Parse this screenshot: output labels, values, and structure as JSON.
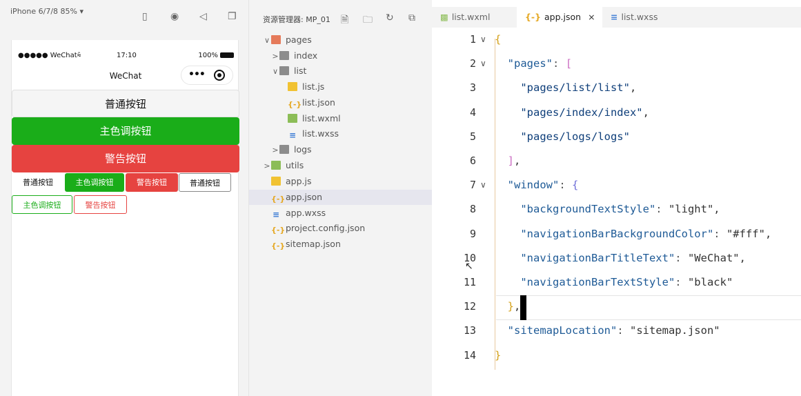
{
  "simulator": {
    "device_label": "iPhone 6/7/8 85% ▾",
    "status": {
      "signal": "●●●●● WeChat⩯",
      "time": "17:10",
      "battery": "100%"
    },
    "navbar_title": "WeChat",
    "capsule_dots": "•••",
    "buttons": {
      "default": "普通按钮",
      "primary": "主色调按钮",
      "warn": "警告按钮",
      "mini_default_1": "普通按钮",
      "mini_primary_1": "主色调按钮",
      "mini_warn_1": "警告按钮",
      "mini_default_2": "普通按钮",
      "mini_primary_plain": "主色调按钮",
      "mini_warn_plain": "警告按钮"
    },
    "tool_icons": [
      "phone-icon",
      "record-icon",
      "volume-icon",
      "window-icon"
    ]
  },
  "explorer": {
    "title": "资源管理器: MP_01",
    "tool_icons": [
      "new-file-icon",
      "new-folder-icon",
      "refresh-icon",
      "collapse-icon"
    ],
    "tree": [
      {
        "label": "pages",
        "chevron": "∨",
        "icon": "folder-red",
        "depth": 0
      },
      {
        "label": "index",
        "chevron": ">",
        "icon": "folder",
        "depth": 1
      },
      {
        "label": "list",
        "chevron": "∨",
        "icon": "folder",
        "depth": 1
      },
      {
        "label": "list.js",
        "chevron": "",
        "icon": "js",
        "depth": 2
      },
      {
        "label": "list.json",
        "chevron": "",
        "icon": "json",
        "depth": 2
      },
      {
        "label": "list.wxml",
        "chevron": "",
        "icon": "wxml",
        "depth": 2
      },
      {
        "label": "list.wxss",
        "chevron": "",
        "icon": "wxss",
        "depth": 2
      },
      {
        "label": "logs",
        "chevron": ">",
        "icon": "folder",
        "depth": 1
      },
      {
        "label": "utils",
        "chevron": ">",
        "icon": "folder-green",
        "depth": 0
      },
      {
        "label": "app.js",
        "chevron": "",
        "icon": "js",
        "depth": 0
      },
      {
        "label": "app.json",
        "chevron": "",
        "icon": "json",
        "depth": 0,
        "selected": true
      },
      {
        "label": "app.wxss",
        "chevron": "",
        "icon": "wxss",
        "depth": 0
      },
      {
        "label": "project.config.json",
        "chevron": "",
        "icon": "json",
        "depth": 0
      },
      {
        "label": "sitemap.json",
        "chevron": "",
        "icon": "json",
        "depth": 0
      }
    ]
  },
  "editor": {
    "tabs": [
      {
        "label": "list.wxml",
        "icon": "wxml-icon",
        "active": false
      },
      {
        "label": "app.json",
        "icon": "json-icon",
        "active": true,
        "close": "×"
      },
      {
        "label": "list.wxss",
        "icon": "wxss-icon",
        "active": false
      }
    ],
    "lines": [
      {
        "n": "1",
        "fold": "∨",
        "text": "{"
      },
      {
        "n": "2",
        "fold": "∨",
        "text": "  \"pages\": ["
      },
      {
        "n": "3",
        "fold": "",
        "text": "    \"pages/list/list\","
      },
      {
        "n": "4",
        "fold": "",
        "text": "    \"pages/index/index\","
      },
      {
        "n": "5",
        "fold": "",
        "text": "    \"pages/logs/logs\""
      },
      {
        "n": "6",
        "fold": "",
        "text": "  ],"
      },
      {
        "n": "7",
        "fold": "∨",
        "text": "  \"window\": {"
      },
      {
        "n": "8",
        "fold": "",
        "text": "    \"backgroundTextStyle\": \"light\","
      },
      {
        "n": "9",
        "fold": "",
        "text": "    \"navigationBarBackgroundColor\": \"#fff\","
      },
      {
        "n": "10",
        "fold": "",
        "text": "    \"navigationBarTitleText\": \"WeChat\","
      },
      {
        "n": "11",
        "fold": "",
        "text": "    \"navigationBarTextStyle\": \"black\""
      },
      {
        "n": "12",
        "fold": "",
        "text": "  },"
      },
      {
        "n": "13",
        "fold": "",
        "text": "  \"sitemapLocation\": \"sitemap.json\""
      },
      {
        "n": "14",
        "fold": "",
        "text": "}"
      }
    ]
  },
  "colors": {
    "primary_green": "#1aad19",
    "warn_red": "#e64340",
    "json_key_blue": "#1e5a96"
  }
}
